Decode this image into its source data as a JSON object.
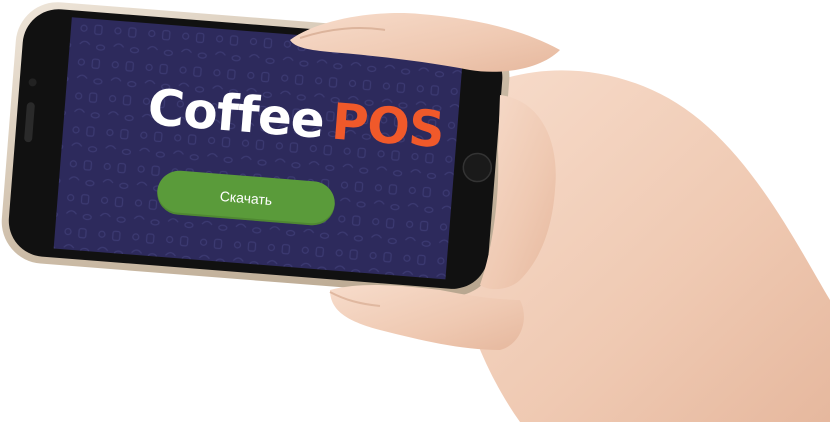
{
  "app": {
    "logo_word_1": "Coffee",
    "logo_word_2": "POS",
    "download_label": "Скачать"
  },
  "colors": {
    "screen_background": "#2d2a5c",
    "logo_primary": "#ffffff",
    "logo_accent": "#f0592a",
    "button": "#5a9b3a",
    "phone_frame": "#d6c8b6",
    "phone_body": "#111111",
    "skin": "#f0d0bc"
  },
  "icons": [
    "coffee-pattern-background"
  ]
}
